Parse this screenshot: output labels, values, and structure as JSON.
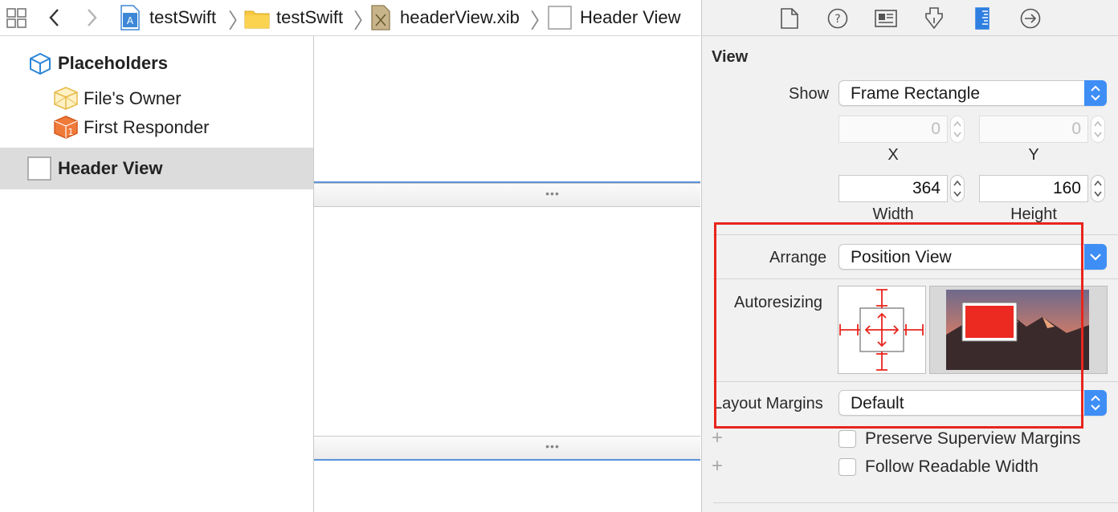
{
  "jumpbar": {
    "crumbs": [
      {
        "label": "testSwift",
        "icon": "xcode-project-icon"
      },
      {
        "label": "testSwift",
        "icon": "folder-icon"
      },
      {
        "label": "headerView.xib",
        "icon": "xib-file-icon"
      },
      {
        "label": "Header View",
        "icon": "view-icon"
      }
    ]
  },
  "outline": {
    "placeholders_label": "Placeholders",
    "files_owner": "File's Owner",
    "first_responder": "First Responder",
    "header_view": "Header View"
  },
  "inspector": {
    "section_title": "View",
    "show": {
      "label": "Show",
      "value": "Frame Rectangle"
    },
    "x": {
      "value": "0",
      "label": "X"
    },
    "y": {
      "value": "0",
      "label": "Y"
    },
    "width": {
      "value": "364",
      "label": "Width"
    },
    "height": {
      "value": "160",
      "label": "Height"
    },
    "arrange": {
      "label": "Arrange",
      "value": "Position View"
    },
    "autoresizing_label": "Autoresizing",
    "layout_margins": {
      "label": "Layout Margins",
      "value": "Default"
    },
    "preserve_superview_margins": "Preserve Superview Margins",
    "follow_readable_width": "Follow Readable Width"
  },
  "colors": {
    "accent": "#3e8ef5",
    "autoresize_red": "#e8251d",
    "canvas_guide_blue": "#5a93d8"
  }
}
